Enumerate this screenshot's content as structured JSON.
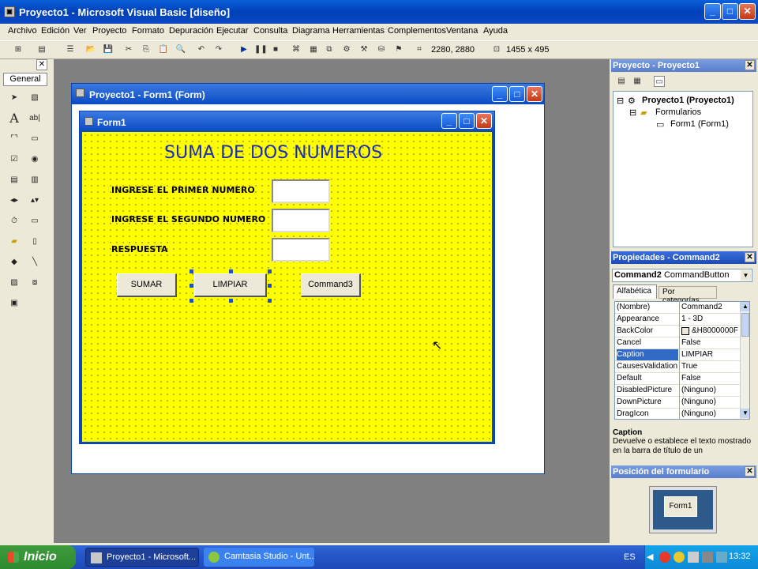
{
  "window": {
    "title": "Proyecto1 - Microsoft Visual Basic [diseño]"
  },
  "menu": [
    "Archivo",
    "Edición",
    "Ver",
    "Proyecto",
    "Formato",
    "Depuración",
    "Ejecutar",
    "Consulta",
    "Diagrama",
    "Herramientas",
    "Complementos",
    "Ventana",
    "Ayuda"
  ],
  "toolbar": {
    "position": "2280, 2880",
    "size": "1455 x 495"
  },
  "toolbox": {
    "title": "General"
  },
  "designer": {
    "title": "Proyecto1 - Form1 (Form)"
  },
  "form": {
    "title": "Form1",
    "heading": "SUMA DE DOS NUMEROS",
    "label1": "INGRESE EL PRIMER NUMERO",
    "label2": "INGRESE EL SEGUNDO NUMERO",
    "label3": "RESPUESTA",
    "btn_sumar": "SUMAR",
    "btn_limpiar": "LIMPIAR",
    "btn_command3": "Command3"
  },
  "project": {
    "title": "Proyecto - Proyecto1",
    "tree_root": "Proyecto1 (Proyecto1)",
    "tree_folder": "Formularios",
    "tree_form": "Form1 (Form1)"
  },
  "properties": {
    "title": "Propiedades - Command2",
    "object": "Command2",
    "object_type": "CommandButton",
    "tab_alpha": "Alfabética",
    "tab_cat": "Por categorías",
    "rows": [
      {
        "name": "(Nombre)",
        "value": "Command2"
      },
      {
        "name": "Appearance",
        "value": "1 - 3D"
      },
      {
        "name": "BackColor",
        "value": "&H8000000F"
      },
      {
        "name": "Cancel",
        "value": "False"
      },
      {
        "name": "Caption",
        "value": "LIMPIAR"
      },
      {
        "name": "CausesValidation",
        "value": "True"
      },
      {
        "name": "Default",
        "value": "False"
      },
      {
        "name": "DisabledPicture",
        "value": "(Ninguno)"
      },
      {
        "name": "DownPicture",
        "value": "(Ninguno)"
      },
      {
        "name": "DragIcon",
        "value": "(Ninguno)"
      }
    ],
    "desc_title": "Caption",
    "desc_text": "Devuelve o establece el texto mostrado en la barra de título de un"
  },
  "formpos": {
    "title": "Posición del formulario",
    "preview": "Form1"
  },
  "taskbar": {
    "start": "Inicio",
    "tasks": [
      "Proyecto1 - Microsoft...",
      "Camtasia Studio - Unt..."
    ],
    "lang": "ES",
    "time": "13:32"
  }
}
